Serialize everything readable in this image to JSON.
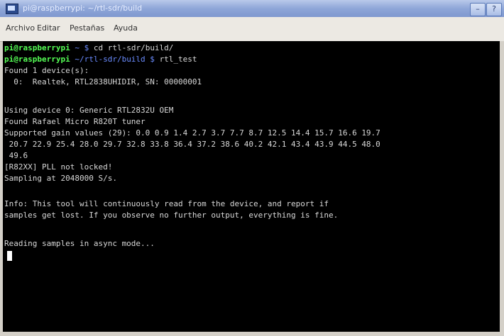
{
  "window": {
    "title": "pi@raspberrypi: ~/rtl-sdr/build",
    "min_glyph": "–",
    "max_glyph": "?"
  },
  "menu": [
    "Archivo",
    "Editar",
    "Pestañas",
    "Ayuda"
  ],
  "terminal": {
    "lines": [
      {
        "prompt": "pi@raspberrypi",
        "cwd": " ~ $ ",
        "text": "cd rtl-sdr/build/"
      },
      {
        "prompt": "pi@raspberrypi",
        "cwd": " ~/rtl-sdr/build $ ",
        "text": "rtl_test"
      },
      {
        "text": "Found 1 device(s):"
      },
      {
        "text": "  0:  Realtek, RTL2838UHIDIR, SN: 00000001"
      },
      {
        "text": ""
      },
      {
        "text": "Using device 0: Generic RTL2832U OEM"
      },
      {
        "text": "Found Rafael Micro R820T tuner"
      },
      {
        "text": "Supported gain values (29): 0.0 0.9 1.4 2.7 3.7 7.7 8.7 12.5 14.4 15.7 16.6 19.7"
      },
      {
        "text": " 20.7 22.9 25.4 28.0 29.7 32.8 33.8 36.4 37.2 38.6 40.2 42.1 43.4 43.9 44.5 48.0"
      },
      {
        "text": " 49.6"
      },
      {
        "text": "[R82XX] PLL not locked!"
      },
      {
        "text": "Sampling at 2048000 S/s."
      },
      {
        "text": ""
      },
      {
        "text": "Info: This tool will continuously read from the device, and report if"
      },
      {
        "text": "samples get lost. If you observe no further output, everything is fine."
      },
      {
        "text": ""
      },
      {
        "text": "Reading samples in async mode..."
      }
    ]
  },
  "colors": {
    "terminal_bg": "#000000",
    "prompt": "#55ff55",
    "path": "#6b8cff",
    "text": "#d8d8d8"
  }
}
